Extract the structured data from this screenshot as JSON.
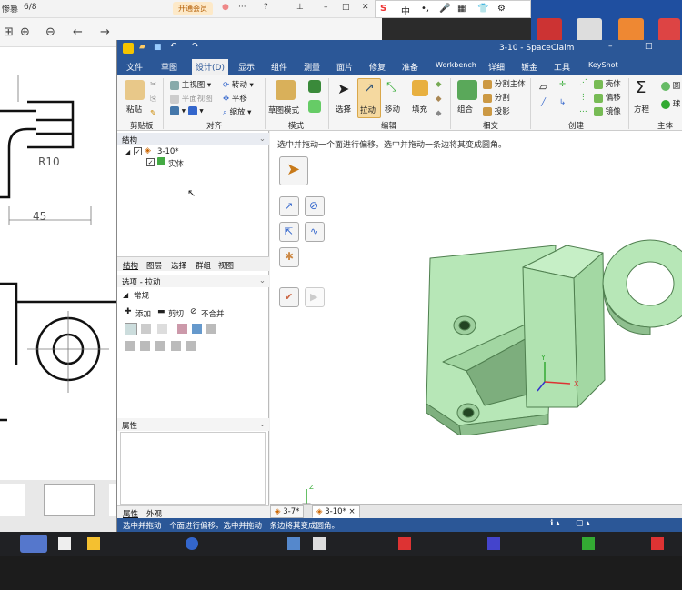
{
  "topbar": {
    "left_text": "惨篡",
    "page": "6/8",
    "vip_button": "开通会员"
  },
  "ime": {
    "chars": [
      "S",
      "中",
      "•,",
      "🎤",
      "▦",
      "👕",
      "⚙"
    ]
  },
  "window": {
    "title": "3-10 - SpaceClaim"
  },
  "menu": [
    "文件",
    "草图",
    "设计(D)",
    "显示",
    "组件",
    "测量",
    "面片",
    "修复",
    "准备",
    "Workbench",
    "详细",
    "钣金",
    "工具",
    "KeyShot"
  ],
  "active_menu": "设计(D)",
  "ribbon": {
    "clipboard": {
      "paste": "粘贴",
      "group": "剪贴板"
    },
    "orient": {
      "main_view": "主视图",
      "plane_view": "平面视图",
      "rotate": "转动",
      "pan": "平移",
      "zoom": "缩放",
      "group": "对齐"
    },
    "mode": {
      "sketch_mode": "草图模式",
      "group": "模式"
    },
    "edit": {
      "select": "选择",
      "pull": "拉动",
      "move": "移动",
      "fill": "填充",
      "group": "编辑"
    },
    "intersect": {
      "combine": "组合",
      "split_body": "分割主体",
      "split": "分割",
      "project": "投影",
      "group": "相交"
    },
    "create": {
      "shell": "壳体",
      "offset": "偏移",
      "mirror": "镜像",
      "group": "创建"
    },
    "body": {
      "equation": "方程",
      "group": "主体"
    }
  },
  "structure": {
    "header": "结构",
    "root": "3-10*",
    "child": "实体",
    "tabs": [
      "结构",
      "图层",
      "选择",
      "群组",
      "视图"
    ]
  },
  "options": {
    "header": "选项 - 拉动",
    "section": "常规",
    "add": "添加",
    "cut": "剪切",
    "no_merge": "不合并"
  },
  "properties": {
    "header": "属性",
    "tabs": [
      "属性",
      "外观"
    ]
  },
  "viewport": {
    "hint": "选中并拖动一个面进行偏移。选中并拖动一条边将其变成圆角。"
  },
  "doc_tabs": [
    "3-7*",
    "3-10*"
  ],
  "status": {
    "text": "选中并拖动一个面进行偏移。选中并拖动一条边将其变成圆角。"
  },
  "drawing": {
    "r_label": "R10",
    "dim_label": "45"
  },
  "colors": {
    "accent": "#2b5797",
    "part": "#a8dfa8",
    "part_edge": "#5a8a5a"
  }
}
